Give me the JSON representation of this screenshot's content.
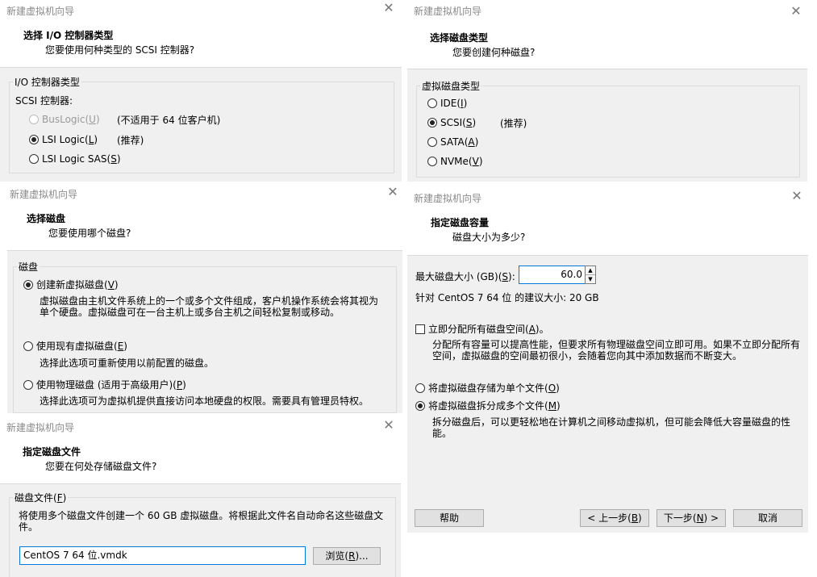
{
  "window_title": "新建虚拟机向导",
  "close_glyph": "✕",
  "io": {
    "title": "选择 I/O 控制器类型",
    "subtitle": "您要使用何种类型的 SCSI 控制器?",
    "group_label": "I/O 控制器类型",
    "scsi_label": "SCSI 控制器:",
    "options": [
      {
        "label": "BusLogic(",
        "key": "U",
        "note": "(不适用于 64 位客户机)",
        "selected": false,
        "disabled": true
      },
      {
        "label": "LSI Logic(",
        "key": "L",
        "note": "(推荐)",
        "selected": true,
        "disabled": false
      },
      {
        "label": "LSI Logic SAS(",
        "key": "S",
        "note": "",
        "selected": false,
        "disabled": false
      }
    ]
  },
  "disktype": {
    "title": "选择磁盘类型",
    "subtitle": "您要创建何种磁盘?",
    "group_label": "虚拟磁盘类型",
    "options": [
      {
        "label": "IDE(",
        "key": "I",
        "note": "",
        "selected": false
      },
      {
        "label": "SCSI(",
        "key": "S",
        "note": "(推荐)",
        "selected": true
      },
      {
        "label": "SATA(",
        "key": "A",
        "note": "",
        "selected": false
      },
      {
        "label": "NVMe(",
        "key": "V",
        "note": "",
        "selected": false
      }
    ]
  },
  "selectdisk": {
    "title": "选择磁盘",
    "subtitle": "您要使用哪个磁盘?",
    "group_label": "磁盘",
    "options": [
      {
        "label": "创建新虚拟磁盘(",
        "key": "V",
        "selected": true,
        "desc1": "虚拟磁盘由主机文件系统上的一个或多个文件组成，客户机操作系统会将其视为",
        "desc2": "单个硬盘。虚拟磁盘可在一台主机上或多台主机之间轻松复制或移动。"
      },
      {
        "label": "使用现有虚拟磁盘(",
        "key": "E",
        "selected": false,
        "desc1": "选择此选项可重新使用以前配置的磁盘。",
        "desc2": ""
      },
      {
        "label": "使用物理磁盘 (适用于高级用户)(",
        "key": "P",
        "selected": false,
        "desc1": "选择此选项可为虚拟机提供直接访问本地硬盘的权限。需要具有管理员特权。",
        "desc2": ""
      }
    ]
  },
  "diskfile": {
    "title": "指定磁盘文件",
    "subtitle": "您要在何处存储磁盘文件?",
    "group_label_pre": "磁盘文件(",
    "group_key": "F",
    "desc1": "将使用多个磁盘文件创建一个 60 GB 虚拟磁盘。将根据此文件名自动命名这些磁盘文",
    "desc2": "件。",
    "filename": "CentOS 7 64 位.vmdk",
    "browse_pre": "浏览(",
    "browse_key": "R",
    "browse_post": ")..."
  },
  "capacity": {
    "title": "指定磁盘容量",
    "subtitle": "磁盘大小为多少?",
    "max_label_pre": "最大磁盘大小 (GB)(",
    "max_key": "S",
    "max_label_post": "):",
    "max_value": "60.0",
    "recommended": "针对 CentOS 7 64 位 的建议大小: 20 GB",
    "allocate_pre": "立即分配所有磁盘空间(",
    "allocate_key": "A",
    "allocate_post": ")。",
    "allocate_checked": false,
    "allocate_desc1": "分配所有容量可以提高性能，但要求所有物理磁盘空间立即可用。如果不立即分配所有",
    "allocate_desc2": "空间，虚拟磁盘的空间最初很小，会随着您向其中添加数据而不断变大。",
    "store_options": [
      {
        "label": "将虚拟磁盘存储为单个文件(",
        "key": "O",
        "selected": false
      },
      {
        "label": "将虚拟磁盘拆分成多个文件(",
        "key": "M",
        "selected": true
      }
    ],
    "split_desc1": "拆分磁盘后，可以更轻松地在计算机之间移动虚拟机，但可能会降低大容量磁盘的性",
    "split_desc2": "能。",
    "buttons": {
      "help": "帮助",
      "back_pre": "< 上一步(",
      "back_key": "B",
      "back_post": ")",
      "next_pre": "下一步(",
      "next_key": "N",
      "next_post": ") >",
      "cancel": "取消"
    }
  }
}
